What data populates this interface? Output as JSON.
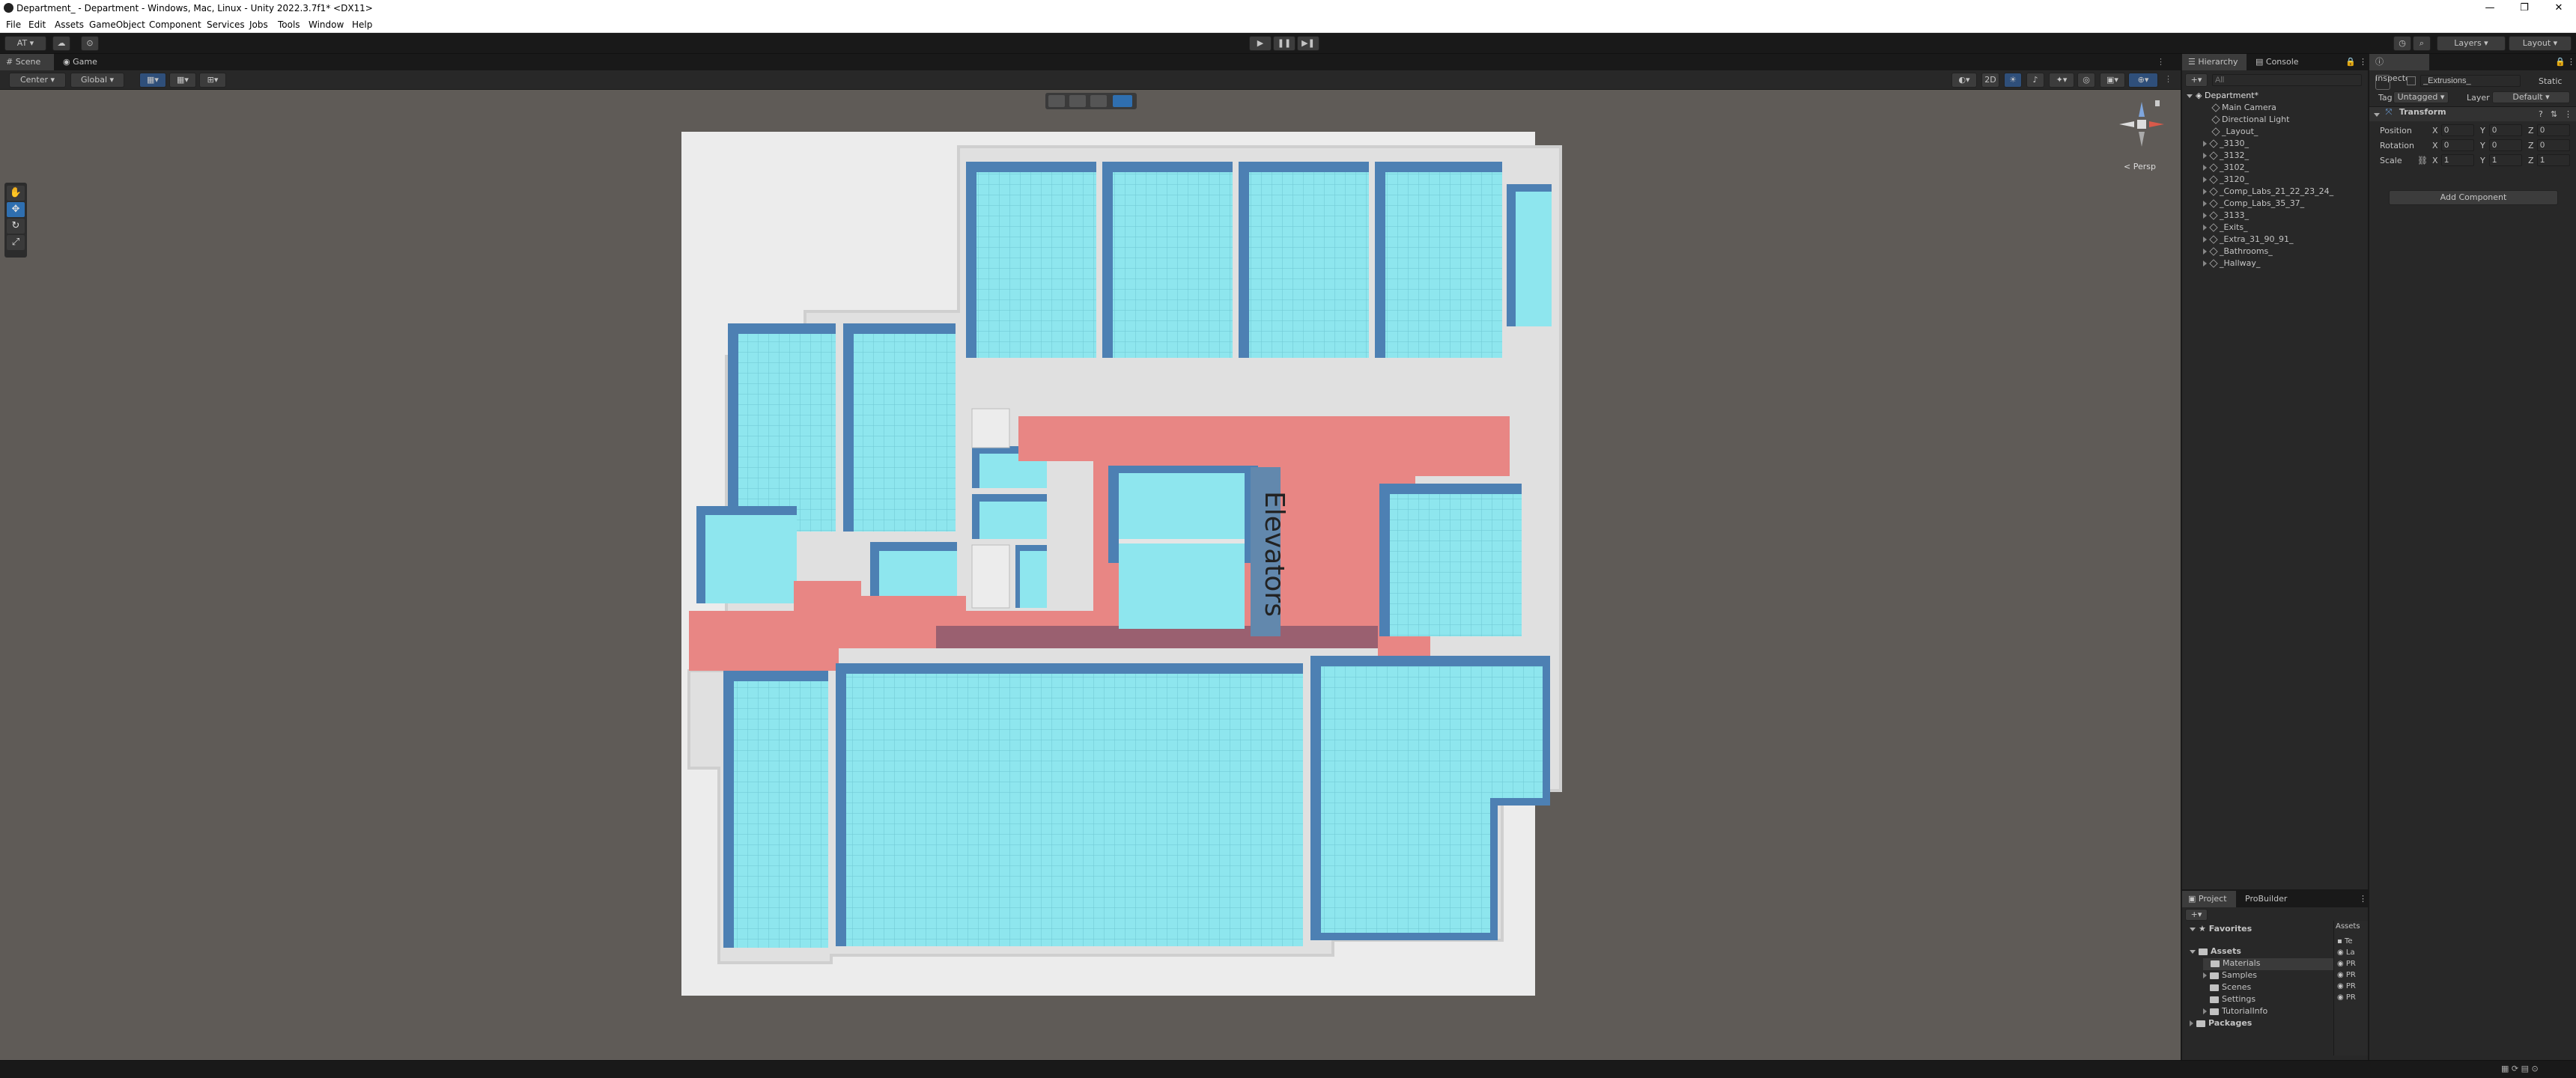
{
  "window": {
    "title": "Department_ - Department - Windows, Mac, Linux - Unity 2022.3.7f1* <DX11>",
    "controls": [
      "—",
      "❐",
      "✕"
    ]
  },
  "menu": [
    "File",
    "Edit",
    "Assets",
    "GameObject",
    "Component",
    "Services",
    "Jobs",
    "Tools",
    "Window",
    "Help"
  ],
  "toolbar": {
    "account": "AT",
    "layers_label": "Layers",
    "layout_label": "Layout"
  },
  "scene_tabs": [
    "Scene",
    "Game"
  ],
  "scene_toolbar": {
    "pivot": "Center",
    "space": "Global"
  },
  "gizmo": {
    "persp_label": "< Persp"
  },
  "floorplan": {
    "label": "Elevators"
  },
  "hierarchy": {
    "tabs": [
      "Hierarchy",
      "Console"
    ],
    "search_placeholder": "All",
    "scene": "Department*",
    "items": [
      "Main Camera",
      "Directional Light",
      "_Layout_",
      "_3130_",
      "_3132_",
      "_3102_",
      "_3120_",
      "_Comp_Labs_21_22_23_24_",
      "_Comp_Labs_35_37_",
      "_3133_",
      "_Exits_",
      "_Extra_31_90_91_",
      "_Bathrooms_",
      "_Hallway_"
    ]
  },
  "inspector": {
    "tab": "Inspector",
    "object_name": "_Extrusions_",
    "static_label": "Static",
    "tag_label": "Tag",
    "tag_value": "Untagged",
    "layer_label": "Layer",
    "layer_value": "Default",
    "component": "Transform",
    "rows": [
      {
        "label": "Position",
        "x": "0",
        "y": "0",
        "z": "0"
      },
      {
        "label": "Rotation",
        "x": "0",
        "y": "0",
        "z": "0"
      },
      {
        "label": "Scale",
        "x": "1",
        "y": "1",
        "z": "1"
      }
    ],
    "add_component": "Add Component"
  },
  "project": {
    "tabs": [
      "Project",
      "ProBuilder"
    ],
    "favorites": "Favorites",
    "assets": "Assets",
    "folders": [
      "Materials",
      "Samples",
      "Scenes",
      "Settings",
      "TutorialInfo"
    ],
    "packages": "Packages",
    "right_header": "Assets",
    "right_items": [
      "Te",
      "La",
      "PR",
      "PR",
      "PR",
      "PR"
    ]
  }
}
